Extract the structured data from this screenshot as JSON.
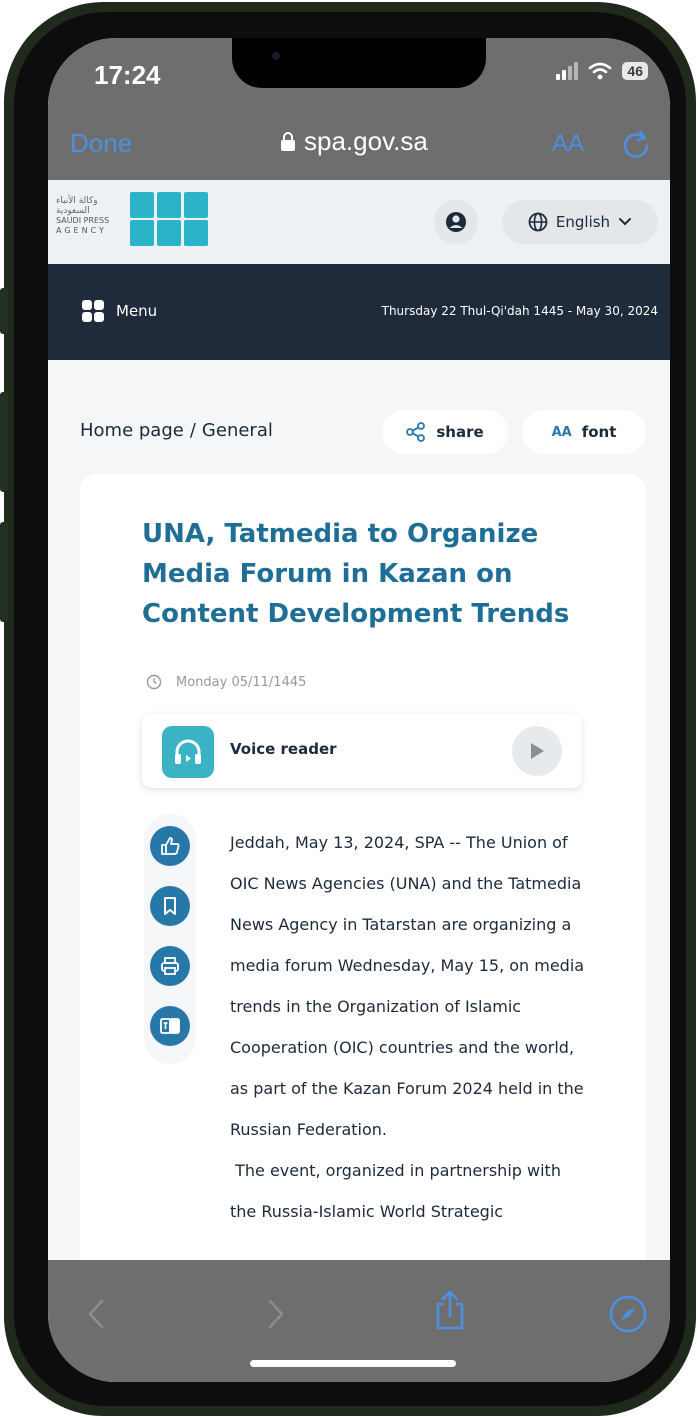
{
  "status": {
    "time": "17:24",
    "battery": "46"
  },
  "safari": {
    "done_label": "Done",
    "url": "spa.gov.sa",
    "text_size_label": "AA"
  },
  "site": {
    "logo_arabic": "وكالة الأنباء السعودية",
    "logo_english_line1": "SAUDI PRESS",
    "logo_english_line2": "AGENCY",
    "language": "English",
    "menu_label": "Menu",
    "date_line": "Thursday 22 Thul-Qi'dah 1445 - May 30, 2024"
  },
  "breadcrumb": {
    "home": "Home page",
    "separator": "/",
    "section": "General"
  },
  "actions": {
    "share_label": "share",
    "font_label": "font",
    "font_icon_text": "AA"
  },
  "article": {
    "title": "UNA, Tatmedia to Organize Media Forum in Kazan on Content Development Trends",
    "date": "Monday 05/11/1445",
    "voice_reader_label": "Voice reader",
    "paragraph1": "Jeddah, May 13, 2024, SPA -- The Union of OIC News Agencies (UNA) and the Tatmedia News Agency in Tatarstan are organizing a media forum Wednesday, May 15, on media trends in the Organization of Islamic Cooperation (OIC) countries and the world, as part of the Kazan Forum 2024 held in the Russian Federation.",
    "paragraph2": " The event, organized in partnership with the Russia-Islamic World Strategic"
  },
  "icons": [
    "signal-icon",
    "wifi-icon",
    "lock-icon",
    "reload-icon",
    "account-icon",
    "globe-icon",
    "chevron-down-icon",
    "menu-icon",
    "share-icon",
    "clock-icon",
    "headphones-icon",
    "play-icon",
    "like-icon",
    "bookmark-icon",
    "print-icon",
    "translate-icon",
    "back-icon",
    "forward-icon",
    "share-sheet-icon",
    "compass-icon"
  ],
  "colors": {
    "accent": "#4d8fe0",
    "brand": "#2bb4c9",
    "title": "#1f6e96",
    "navbar": "#1f2a3a",
    "tool": "#2778a8"
  }
}
